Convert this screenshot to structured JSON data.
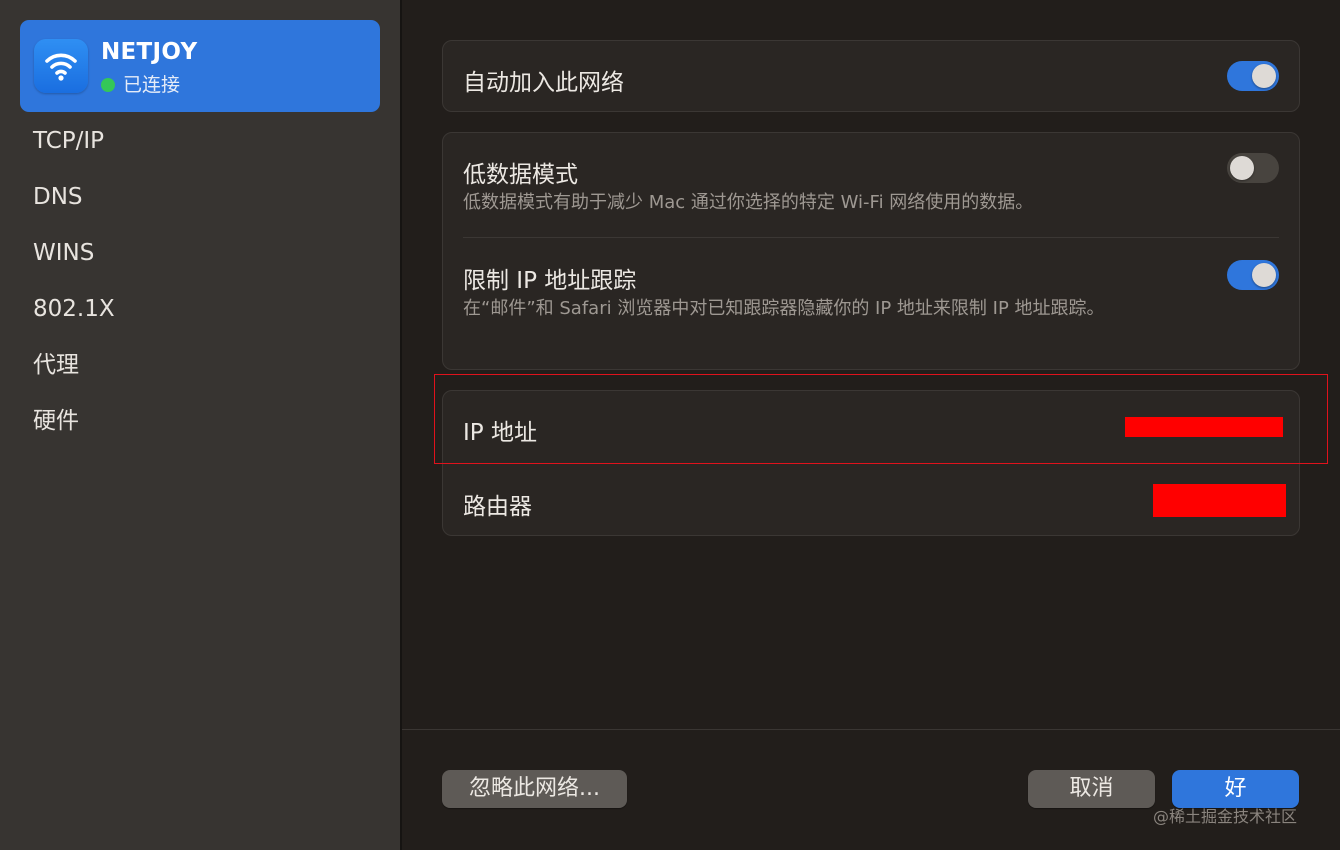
{
  "sidebar": {
    "network": {
      "name": "NETJOY",
      "status": "已连接",
      "status_color": "#34c759",
      "icon": "wifi-icon"
    },
    "items": [
      "TCP/IP",
      "DNS",
      "WINS",
      "802.1X",
      "代理",
      "硬件"
    ]
  },
  "settings": {
    "auto_join": {
      "label": "自动加入此网络",
      "enabled": true
    },
    "low_data": {
      "label": "低数据模式",
      "description": "低数据模式有助于减少 Mac 通过你选择的特定 Wi-Fi 网络使用的数据。",
      "enabled": false
    },
    "limit_ip": {
      "label": "限制 IP 地址跟踪",
      "description": "在“邮件”和 Safari 浏览器中对已知跟踪器隐藏你的 IP 地址来限制 IP 地址跟踪。",
      "enabled": true
    },
    "ip_address": {
      "label": "IP 地址",
      "value_redacted": true
    },
    "router": {
      "label": "路由器",
      "value_redacted": true
    }
  },
  "footer": {
    "forget_label": "忽略此网络...",
    "cancel_label": "取消",
    "ok_label": "好"
  },
  "watermark": "@稀土掘金技术社区",
  "colors": {
    "accent": "#2f76dc",
    "redaction": "#ff0000",
    "highlight_border": "#e0121c"
  }
}
